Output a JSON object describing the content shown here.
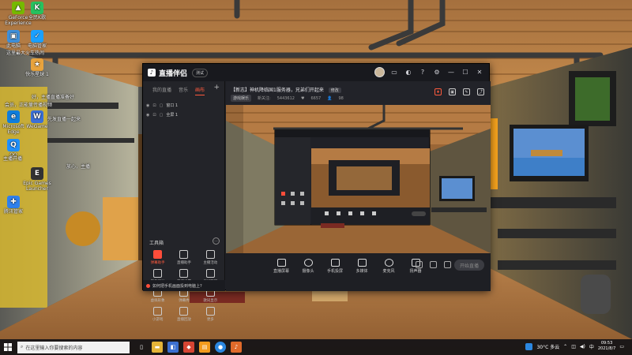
{
  "desktop": {
    "icons": [
      {
        "label": "GeForce Experience",
        "color": "#76b900",
        "glyph": "▲"
      },
      {
        "label": "全民K歌",
        "color": "#27c15f",
        "glyph": "K"
      },
      {
        "label": "此电脑",
        "color": "#3f8fd9",
        "glyph": "▣"
      },
      {
        "label": "电脑管家",
        "color": "#1aa0ff",
        "glyph": "✓"
      },
      {
        "label": "快乐星球 1",
        "color": "#e8a33d",
        "glyph": "★"
      },
      {
        "label": "QQ",
        "color": "#1e90ff",
        "glyph": "Q"
      },
      {
        "label": "WeGame",
        "color": "#3a6fd8",
        "glyph": "W"
      },
      {
        "label": "Microsoft Edge",
        "color": "#0f7ddb",
        "glyph": "e"
      },
      {
        "label": "Epic Games Launcher",
        "color": "#333333",
        "glyph": "E"
      },
      {
        "label": "腾讯管家",
        "color": "#2f80ed",
        "glyph": "✚"
      }
    ],
    "overlay_texts": [
      "这里最大火车热闹",
      "好，主播直播准备好",
      "会员，正能量传播视频",
      "先发直播一起来",
      "放心，主播",
      "主播开播"
    ]
  },
  "app": {
    "title": "直播伴侣",
    "version": "测试",
    "window_controls": [
      "—",
      "☐",
      "✕"
    ],
    "left_panel": {
      "tabs": [
        "我的直播",
        "音乐",
        "画布"
      ],
      "active_tab": 2,
      "plus": "+",
      "scenes": [
        {
          "label": "窗口 1"
        },
        {
          "label": "全屏 1"
        }
      ],
      "tools_title": "工具箱",
      "tools_more": "···",
      "tools": [
        {
          "label": "弹幕助手",
          "active": true
        },
        {
          "label": "直播助手"
        },
        {
          "label": "主播活动"
        },
        {
          "label": "我的活动"
        },
        {
          "label": "开播设置"
        },
        {
          "label": "房间管理"
        },
        {
          "label": "虚拟形象"
        },
        {
          "label": "弹幕秀"
        },
        {
          "label": "歌词显示"
        },
        {
          "label": "小游戏"
        },
        {
          "label": "直播回放"
        },
        {
          "label": "更多"
        }
      ],
      "notice": "如何把手机画面投到电脑上?"
    },
    "room": {
      "title": "【新志】神机降临国1服务器，兄弟们开起来",
      "edit_label": "修改",
      "category": "游戏娱乐",
      "fans_label": "新关注:",
      "fans": "5443612",
      "likes": "6657",
      "viewers": "98"
    },
    "bottom_toolbar": {
      "items": [
        "直播屏幕",
        "摄像头",
        "手机投屏",
        "多媒体",
        "麦克风",
        "扬声器"
      ],
      "start_label": "开始直播"
    }
  },
  "taskbar": {
    "search_placeholder": "在这里输入你要搜索的内容",
    "weather": "30°C 多云",
    "time": "09:53",
    "date": "2021/8/7",
    "lang": "中"
  }
}
